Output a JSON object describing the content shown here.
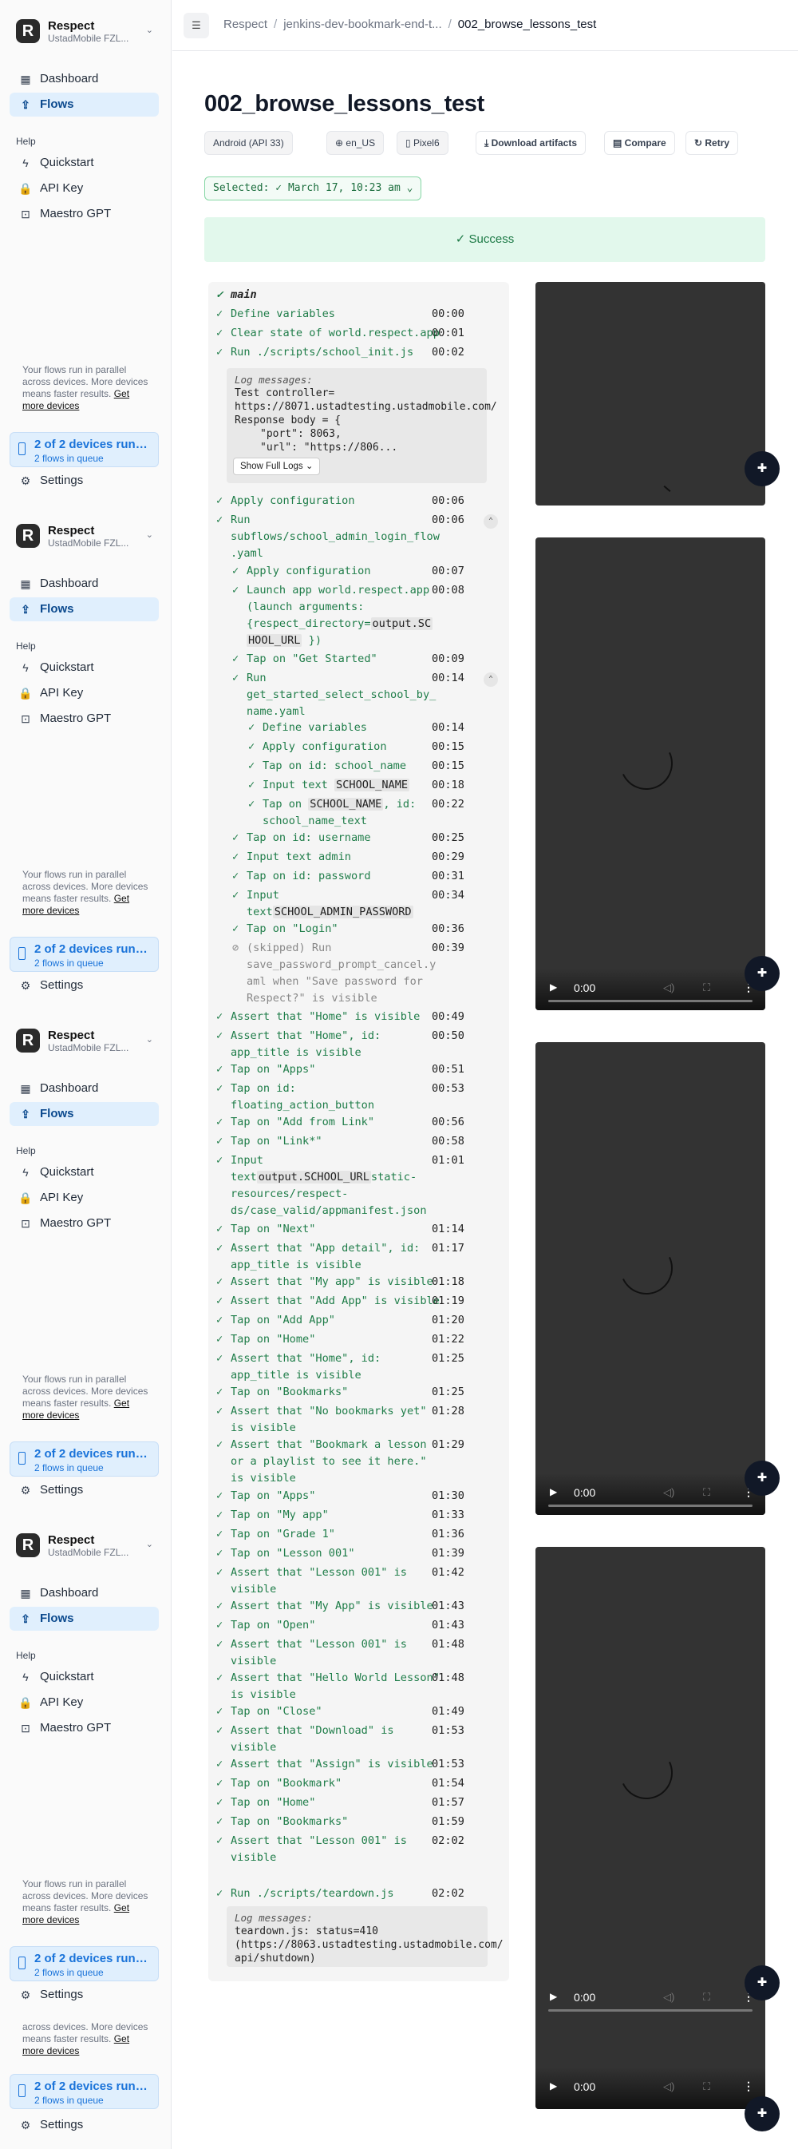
{
  "sidebar": {
    "org_name": "Respect",
    "org_sub": "UstadMobile FZL...",
    "nav_dashboard": "Dashboard",
    "nav_flows": "Flows",
    "help_label": "Help",
    "nav_quickstart": "Quickstart",
    "nav_apikey": "API Key",
    "nav_maestrogpt": "Maestro GPT",
    "run_info_prefix": "Your flows run in parallel across devices. More devices means faster results.",
    "run_info_short_prefix": "across devices. More devices means faster results.",
    "run_info_link": "Get more devices",
    "devices_title": "2 of 2 devices running",
    "devices_sub": "2 flows in queue",
    "settings": "Settings"
  },
  "header": {
    "crumb1": "Respect",
    "crumb2": "jenkins-dev-bookmark-end-t...",
    "crumb3": "002_browse_lessons_test"
  },
  "page": {
    "title": "002_browse_lessons_test",
    "platform": "Android (API 33)",
    "locale": "en_US",
    "device": "Pixel6",
    "download_label": "Download artifacts",
    "compare_label": "Compare",
    "retry_label": "Retry",
    "selected_label": "Selected:",
    "selected_value": "March 17, 10:23 am",
    "status": "Success"
  },
  "steps": {
    "main": "main",
    "s1": "Define variables",
    "t1": "00:00",
    "s2": "Clear state of world.respect.app",
    "t2": "00:01",
    "s3": "Run ./scripts/school_init.js",
    "t3": "00:02",
    "log1_head": "Log messages:",
    "log1_l1": "Test controller=",
    "log1_l2": "https://8071.ustadtesting.ustadmobile.com/",
    "log1_l3": "Response body = {",
    "log1_l4": "\"port\": 8063,",
    "log1_l5": "\"url\": \"https://806...",
    "show_full": "Show Full Logs",
    "s4": "Apply configuration",
    "t4": "00:06",
    "s5a": "Run",
    "s5b": "subflows/school_admin_login_flow",
    ".yaml": "",
    "s5c": ".yaml",
    "t5": "00:06",
    "s6": "Apply configuration",
    "t6": "00:07",
    "s7a": "Launch app world.respect.app",
    "s7b": "(launch arguments:",
    "s7c": "{respect_directory=",
    "s7v": "output.SC",
    "s7d": "HOOL_URL",
    "s7e": " })",
    "t7": "00:08",
    "s8": "Tap on \"Get Started\"",
    "t8": "00:09",
    "s9a": "Run",
    "s9b": "get_started_select_school_by_",
    "s9c": "name.yaml",
    "t9": "00:14",
    "s10": "Define variables",
    "t10": "00:14",
    "s11": "Apply configuration",
    "t11": "00:15",
    "s12": "Tap on id: school_name",
    "t12": "00:15",
    "s13a": "Input text ",
    "s13v": "SCHOOL_NAME",
    "t13": "00:18",
    "s14a": "Tap on ",
    "s14v": "SCHOOL_NAME",
    "s14b": ", id:",
    "s14c": "school_name_text",
    "t14": "00:22",
    "s15": "Tap on id: username",
    "t15": "00:25",
    "s16": "Input text admin",
    "t16": "00:29",
    "s17": "Tap on id: password",
    "t17": "00:31",
    "s18a": "Input",
    "s18b": "text",
    "s18v": "SCHOOL_ADMIN_PASSWORD",
    "t18": "00:34",
    "s19": "Tap on \"Login\"",
    "t19": "00:36",
    "s20a": "(skipped) Run",
    "s20b": "save_password_prompt_cancel.y",
    "s20c": "aml when \"Save password for",
    "s20d": "Respect?\" is visible",
    "t20": "00:39",
    "s21": "Assert that \"Home\" is visible",
    "t21": "00:49",
    "s22a": "Assert that \"Home\", id:",
    "s22b": "app_title is visible",
    "t22": "00:50",
    "s23": "Tap on \"Apps\"",
    "t23": "00:51",
    "s24a": "Tap on id:",
    "s24b": "floating_action_button",
    "t24": "00:53",
    "s25": "Tap on \"Add from Link\"",
    "t25": "00:56",
    "s26": "Tap on \"Link*\"",
    "t26": "00:58",
    "s27a": "Input",
    "s27b": "text",
    "s27v": "output.SCHOOL_URL",
    "s27c": "static-",
    "s27d": "resources/respect-",
    "s27e": "ds/case_valid/appmanifest.json",
    "t27": "01:01",
    "s28": "Tap on \"Next\"",
    "t28": "01:14",
    "s29a": "Assert that \"App detail\", id:",
    "s29b": "app_title is visible",
    "t29": "01:17",
    "s30": "Assert that \"My app\" is visible",
    "t30": "01:18",
    "s31": "Assert that \"Add App\" is visible",
    "t31": "01:19",
    "s32": "Tap on \"Add App\"",
    "t32": "01:20",
    "s33": "Tap on \"Home\"",
    "t33": "01:22",
    "s34a": "Assert that \"Home\", id:",
    "s34b": "app_title is visible",
    "t34": "01:25",
    "s35": "Tap on \"Bookmarks\"",
    "t35": "01:25",
    "s36a": "Assert that \"No bookmarks yet\"",
    "s36b": "is visible",
    "t36": "01:28",
    "s37a": "Assert that \"Bookmark a lesson",
    "s37b": "or a playlist to see it here.\"",
    "s37c": "is visible",
    "t37": "01:29",
    "s38": "Tap on \"Apps\"",
    "t38": "01:30",
    "s39": "Tap on \"My app\"",
    "t39": "01:33",
    "s40": "Tap on \"Grade 1\"",
    "t40": "01:36",
    "s41": "Tap on \"Lesson 001\"",
    "t41": "01:39",
    "s42a": "Assert that \"Lesson 001\" is",
    "s42b": "visible",
    "t42": "01:42",
    "s43": "Assert that \"My App\" is visible",
    "t43": "01:43",
    "s44": "Tap on \"Open\"",
    "t44": "01:43",
    "s45a": "Assert that \"Lesson 001\" is",
    "s45b": "visible",
    "t45": "01:48",
    "s46a": "Assert that \"Hello World Lesson\"",
    "s46b": "is visible",
    "t46": "01:48",
    "s47": "Tap on \"Close\"",
    "t47": "01:49",
    "s48a": "Assert that \"Download\" is",
    "s48b": "visible",
    "t48": "01:53",
    "s49": "Assert that \"Assign\" is visible",
    "t49": "01:53",
    "s50": "Tap on \"Bookmark\"",
    "t50": "01:54",
    "s51": "Tap on \"Home\"",
    "t51": "01:57",
    "s52": "Tap on \"Bookmarks\"",
    "t52": "01:59",
    "s53a": "Assert that \"Lesson 001\" is",
    "s53b": "visible",
    "t53": "02:02",
    "s54": "Run ./scripts/teardown.js",
    "t54": "02:02",
    "log2_head": "Log messages:",
    "log2_l1": "teardown.js: status=410",
    "log2_l2": "(https://8063.ustadtesting.ustadmobile.com/",
    "log2_l3": "api/shutdown)"
  },
  "video": {
    "time": "0:00"
  },
  "icons": {
    "check": "✓",
    "chevron": "⌄",
    "feedback": "chat-plus-icon"
  },
  "colors": {
    "accent": "#1a73d9",
    "success": "#1d7a46",
    "success_bg": "#e2f8ec"
  }
}
